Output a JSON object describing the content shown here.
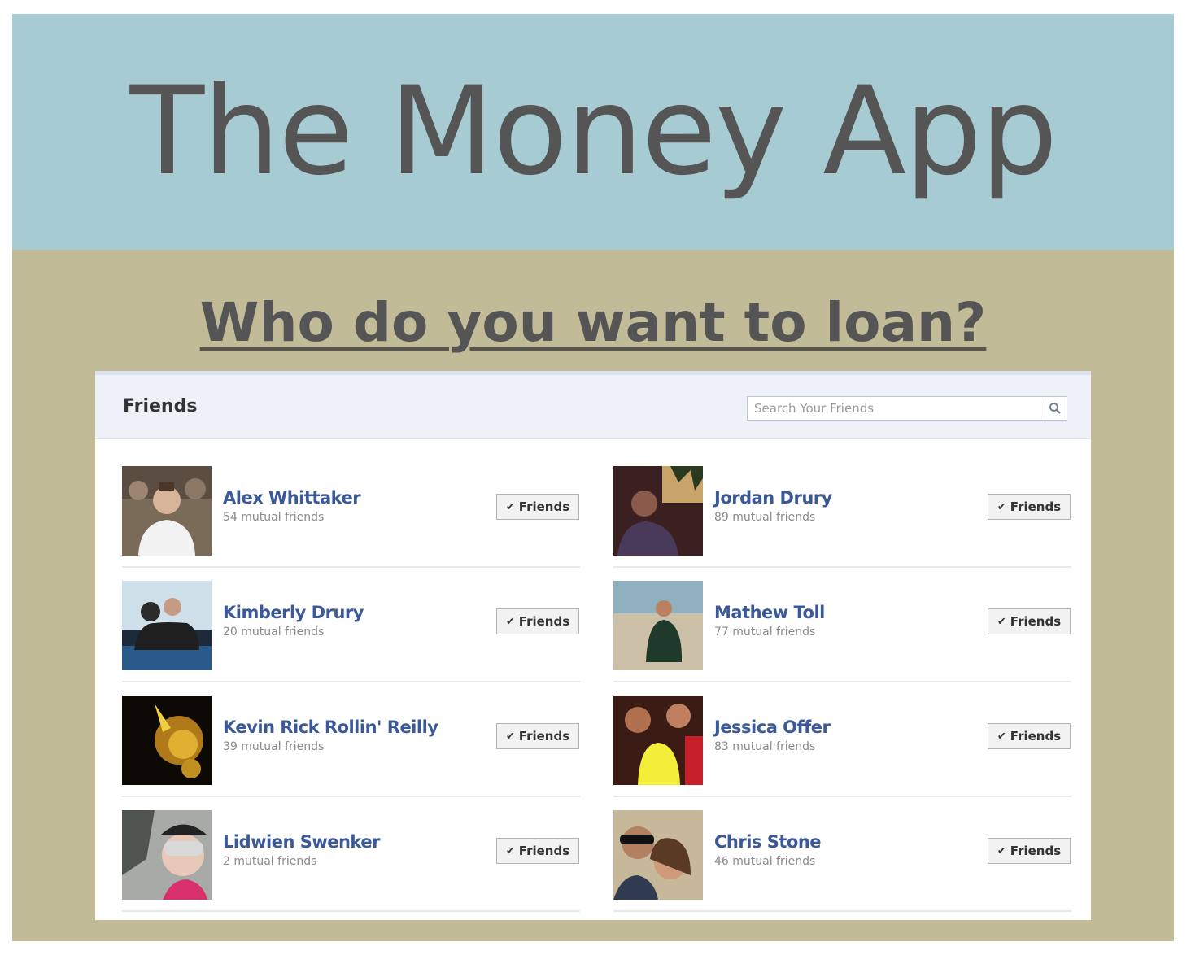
{
  "slide": {
    "title": "The Money App",
    "subtitle": "Who do you want to loan?"
  },
  "panel": {
    "header_title": "Friends",
    "search_placeholder": "Search Your Friends",
    "search_icon": "magnifier-icon"
  },
  "friend_button_label": "Friends",
  "friends": [
    {
      "name": "Alex Whittaker",
      "mutual": "54 mutual friends"
    },
    {
      "name": "Jordan Drury",
      "mutual": "89 mutual friends"
    },
    {
      "name": "Kimberly Drury",
      "mutual": "20 mutual friends"
    },
    {
      "name": "Mathew Toll",
      "mutual": "77 mutual friends"
    },
    {
      "name": "Kevin Rick Rollin' Reilly",
      "mutual": "39 mutual friends"
    },
    {
      "name": "Jessica Offer",
      "mutual": "83 mutual friends"
    },
    {
      "name": "Lidwien Swenker",
      "mutual": "2 mutual friends"
    },
    {
      "name": "Chris Stone",
      "mutual": "46 mutual friends"
    }
  ],
  "colors": {
    "title_band": "#a6cbd2",
    "slide_background": "#c1bb97",
    "title_text": "#555555",
    "friend_name_link": "#3b5998"
  }
}
